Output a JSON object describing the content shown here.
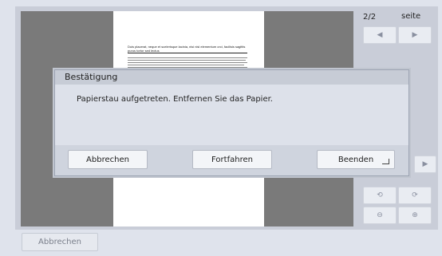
{
  "viewer": {
    "page_counter": "2/2",
    "page_label": "seite",
    "doc_heading": "Duis placerat, neque et scelerisque lacinia, nisi nisl elementum orci, facilisis sagittis purus tortor sed lectus"
  },
  "nav": {
    "prev_icon": "chevron-left-icon",
    "next_icon": "chevron-right-icon",
    "rotate_ccw_icon": "rotate-left-icon",
    "rotate_cw_icon": "rotate-right-icon",
    "zoom_out_icon": "zoom-out-icon",
    "zoom_in_icon": "zoom-in-icon"
  },
  "dialog": {
    "title": "Bestätigung",
    "message": "Papierstau aufgetreten. Entfernen Sie das Papier.",
    "cancel_label": "Abbrechen",
    "continue_label": "Fortfahren",
    "end_label": "Beenden"
  },
  "footer": {
    "cancel_label": "Abbrechen"
  }
}
